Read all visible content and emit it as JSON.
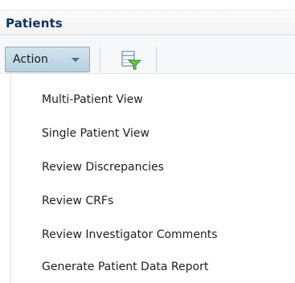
{
  "panel": {
    "title": "Patients"
  },
  "toolbar": {
    "action_label": "Action",
    "action_icon": "chevron-down-icon",
    "filter_icon": "filter-icon"
  },
  "menu": {
    "items": [
      {
        "label": "Multi-Patient View"
      },
      {
        "label": "Single Patient View"
      },
      {
        "label": "Review Discrepancies"
      },
      {
        "label": "Review CRFs"
      },
      {
        "label": "Review Investigator Comments"
      },
      {
        "label": "Generate Patient Data Report"
      }
    ]
  }
}
